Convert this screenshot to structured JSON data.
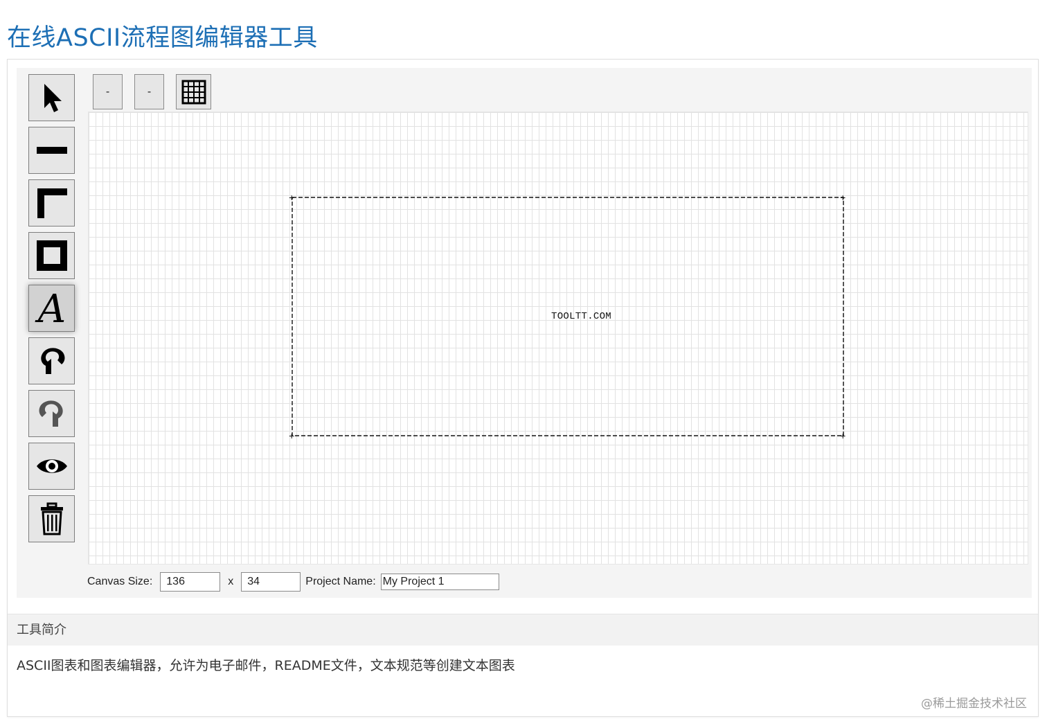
{
  "page": {
    "title": "在线ASCII流程图编辑器工具"
  },
  "toolbar": {
    "tools": [
      {
        "icon": "pointer-icon"
      },
      {
        "icon": "line-icon"
      },
      {
        "icon": "corner-line-icon"
      },
      {
        "icon": "box-icon"
      },
      {
        "icon": "text-icon",
        "active": true
      },
      {
        "icon": "undo-icon"
      },
      {
        "icon": "redo-icon"
      },
      {
        "icon": "eye-icon"
      },
      {
        "icon": "trash-icon"
      }
    ],
    "zoom_out_1": "-",
    "zoom_out_2": "-",
    "grid_toggle_icon": "grid-icon"
  },
  "canvas": {
    "text": "TOOLTT.COM"
  },
  "footer": {
    "canvas_size_label": "Canvas Size:",
    "width_value": "136",
    "x_label": "x",
    "height_value": "34",
    "project_name_label": "Project Name:",
    "project_name_value": "My Project 1"
  },
  "intro": {
    "heading": "工具简介",
    "body": "ASCII图表和图表编辑器，允许为电子邮件，README文件，文本规范等创建文本图表"
  },
  "watermark": "@稀土掘金技术社区",
  "colors": {
    "title": "#1d6fb5",
    "grid": "#e2e2e2",
    "button_bg": "#e6e6e6"
  }
}
